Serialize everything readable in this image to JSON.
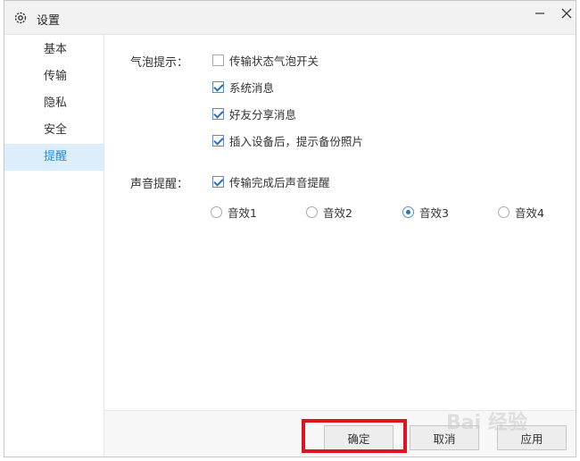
{
  "window": {
    "title": "设置"
  },
  "sidebar": {
    "items": [
      {
        "label": "基本"
      },
      {
        "label": "传输"
      },
      {
        "label": "隐私"
      },
      {
        "label": "安全"
      },
      {
        "label": "提醒",
        "active": true
      }
    ]
  },
  "bubble": {
    "label": "气泡提示：",
    "options": [
      {
        "label": "传输状态气泡开关",
        "checked": false
      },
      {
        "label": "系统消息",
        "checked": true
      },
      {
        "label": "好友分享消息",
        "checked": true
      },
      {
        "label": "插入设备后，提示备份照片",
        "checked": true
      }
    ]
  },
  "sound": {
    "label": "声音提醒：",
    "toggle": {
      "label": "传输完成后声音提醒",
      "checked": true
    },
    "effects": [
      {
        "label": "音效1",
        "selected": false
      },
      {
        "label": "音效2",
        "selected": false
      },
      {
        "label": "音效3",
        "selected": true
      },
      {
        "label": "音效4",
        "selected": false
      }
    ]
  },
  "footer": {
    "ok_label": "确定",
    "cancel_label": "取消",
    "apply_label": "应用"
  },
  "watermark": {
    "text": "Bai 经验"
  },
  "colors": {
    "accent": "#2b8ad8",
    "active_bg": "#dceefb",
    "highlight": "#e0141e"
  }
}
